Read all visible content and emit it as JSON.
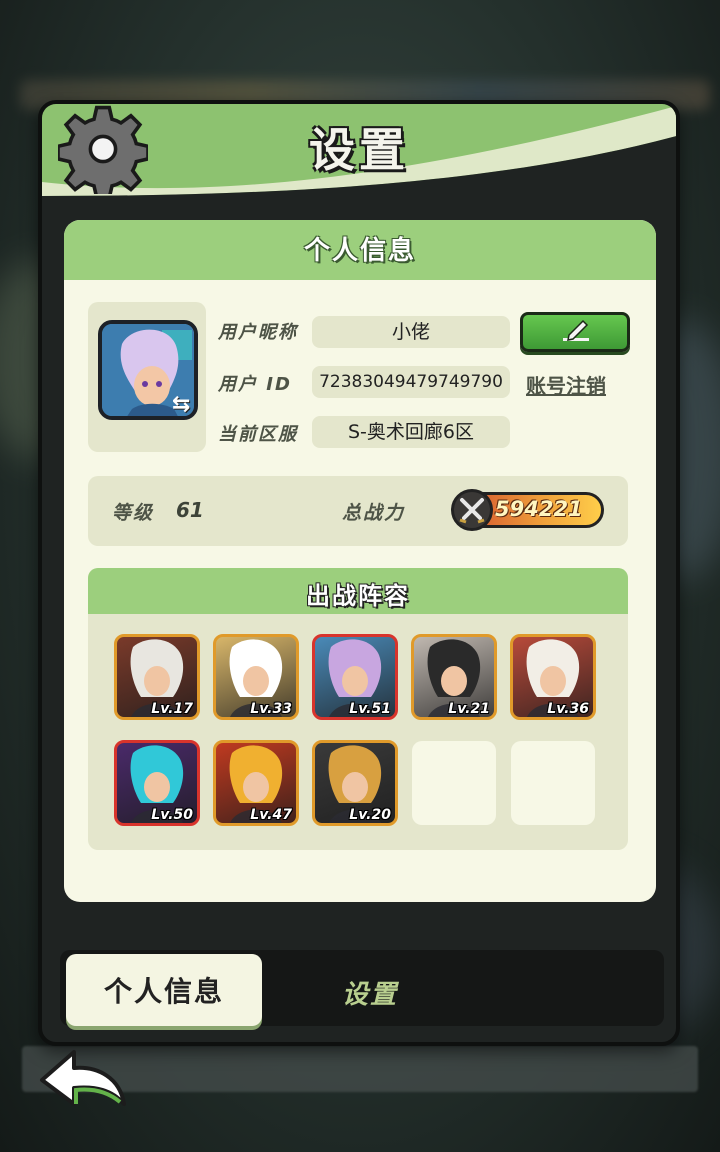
{
  "window": {
    "title": "设置"
  },
  "profile": {
    "section_title": "个人信息",
    "nickname_label": "用户昵称",
    "nickname_value": "小佬",
    "id_label": "用户 ID",
    "id_value": "72383049479749790",
    "server_label": "当前区服",
    "server_value": "S-奥术回廊6区",
    "deregister_label": "账号注销",
    "edit_icon": "pencil-icon",
    "swap_icon": "swap-arrows-icon"
  },
  "stats": {
    "level_label": "等级",
    "level_value": "61",
    "power_label": "总战力",
    "power_value": "594221",
    "power_icon": "crossed-swords-icon"
  },
  "lineup": {
    "title": "出战阵容",
    "heroes": [
      {
        "level": "Lv.17",
        "frame": "#e09a2a",
        "bg": "#7a3a2a",
        "accent": "#e8e6e0"
      },
      {
        "level": "Lv.33",
        "frame": "#e09a2a",
        "bg": "#d8b66a",
        "accent": "#ffffff"
      },
      {
        "level": "Lv.51",
        "frame": "#d8342c",
        "bg": "#4a8ab8",
        "accent": "#c8a6e0"
      },
      {
        "level": "Lv.21",
        "frame": "#e09a2a",
        "bg": "#c0b8b0",
        "accent": "#2a2a2a"
      },
      {
        "level": "Lv.36",
        "frame": "#e09a2a",
        "bg": "#b84a3a",
        "accent": "#f2eee6"
      },
      {
        "level": "Lv.50",
        "frame": "#d8342c",
        "bg": "#4a2a6a",
        "accent": "#30c8d8"
      },
      {
        "level": "Lv.47",
        "frame": "#e09a2a",
        "bg": "#c03a20",
        "accent": "#f0b030"
      },
      {
        "level": "Lv.20",
        "frame": "#e09a2a",
        "bg": "#3a3a3a",
        "accent": "#d8a040"
      }
    ],
    "empty_slots": 2
  },
  "tabs": {
    "active": "个人信息",
    "inactive": "设置"
  },
  "background_hint": "",
  "colors": {
    "header_green": "#8dc270",
    "card_cream": "#f7f8e6",
    "edit_green": "#4fb23f"
  }
}
